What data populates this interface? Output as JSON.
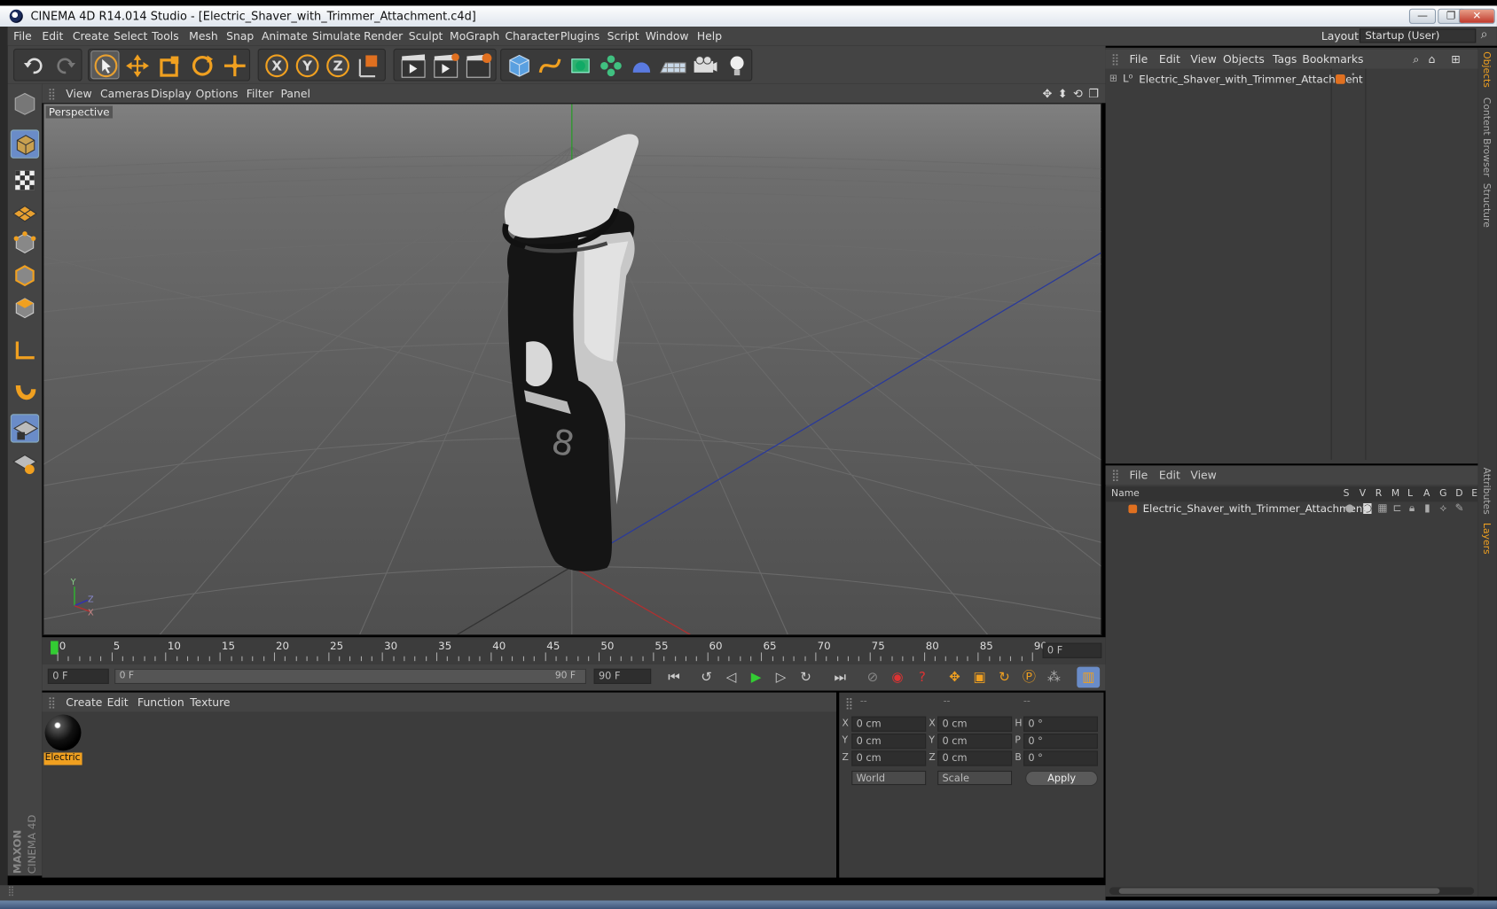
{
  "window": {
    "title": "CINEMA 4D R14.014 Studio - [Electric_Shaver_with_Trimmer_Attachment.c4d]",
    "controls": [
      "—",
      "❐",
      "✕"
    ]
  },
  "menubar": {
    "items": [
      "File",
      "Edit",
      "Create",
      "Select",
      "Tools",
      "Mesh",
      "Snap",
      "Animate",
      "Simulate",
      "Render",
      "Sculpt",
      "MoGraph",
      "Character",
      "Plugins",
      "Script",
      "Window",
      "Help"
    ],
    "layout_label": "Layout:",
    "layout_value": "Startup (User)"
  },
  "viewport": {
    "menu": [
      "View",
      "Cameras",
      "Display",
      "Options",
      "Filter",
      "Panel"
    ],
    "label": "Perspective",
    "axis_y": "Y",
    "axis_z": "Z",
    "axis_x": "X"
  },
  "timeline": {
    "labels": [
      "0",
      "5",
      "10",
      "15",
      "20",
      "25",
      "30",
      "35",
      "40",
      "45",
      "50",
      "55",
      "60",
      "65",
      "70",
      "75",
      "80",
      "85",
      "90"
    ],
    "current_frame": "0 F",
    "start_field": "0 F",
    "slider_start": "0 F",
    "slider_end": "90 F",
    "end_field": "90 F"
  },
  "material_manager": {
    "menu": [
      "Create",
      "Edit",
      "Function",
      "Texture"
    ],
    "material_name": "Electric"
  },
  "coordinates": {
    "headers": [
      "--",
      "--",
      "--"
    ],
    "rows": [
      {
        "pos_axis": "X",
        "pos": "0 cm",
        "size_axis": "X",
        "size": "0 cm",
        "rot_axis": "H",
        "rot": "0 °"
      },
      {
        "pos_axis": "Y",
        "pos": "0 cm",
        "size_axis": "Y",
        "size": "0 cm",
        "rot_axis": "P",
        "rot": "0 °"
      },
      {
        "pos_axis": "Z",
        "pos": "0 cm",
        "size_axis": "Z",
        "size": "0 cm",
        "rot_axis": "B",
        "rot": "0 °"
      }
    ],
    "mode": "World",
    "transform": "Scale",
    "apply": "Apply"
  },
  "object_manager": {
    "menu": [
      "File",
      "Edit",
      "View",
      "Objects",
      "Tags",
      "Bookmarks"
    ],
    "object_name": "Electric_Shaver_with_Trimmer_Attachment"
  },
  "layer_manager": {
    "menu": [
      "File",
      "Edit",
      "View"
    ],
    "col_name": "Name",
    "columns": [
      "S",
      "V",
      "R",
      "M",
      "L",
      "A",
      "G",
      "D",
      "E"
    ],
    "layer_name": "Electric_Shaver_with_Trimmer_Attachment"
  },
  "side_tabs": [
    "Objects",
    "Content Browser",
    "Structure",
    "Attributes",
    "Layers"
  ],
  "branding": {
    "maxon": "MAXON",
    "product": "CINEMA 4D"
  },
  "colors": {
    "accent": "#f0a020",
    "panel": "#3c3c3c",
    "active_tab": "#6a8cc8"
  }
}
